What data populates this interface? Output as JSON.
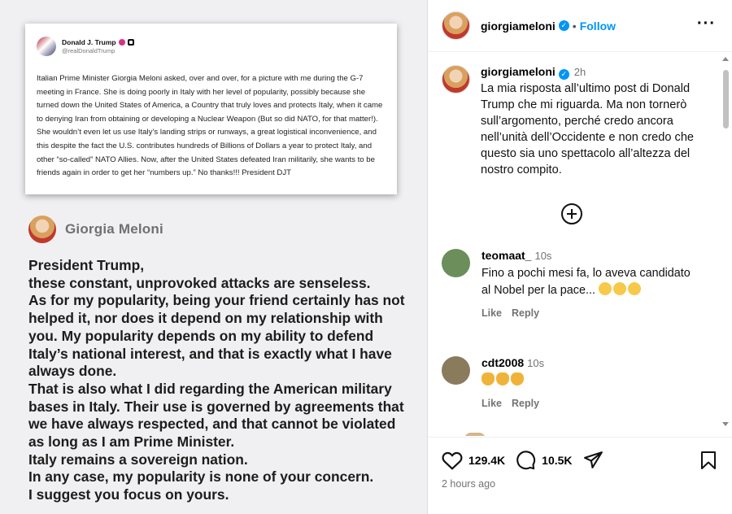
{
  "post_image": {
    "tweet": {
      "name": "Donald J. Trump",
      "handle": "@realDonaldTrump",
      "text": "Italian Prime Minister Giorgia Meloni asked, over and over, for a picture with me during the G-7 meeting in France. She is doing poorly in Italy with her level of popularity, possibly because she turned down the United States of America, a Country that truly loves and protects Italy, when it came to denying Iran from obtaining or developing a Nuclear Weapon (But so did NATO, for that matter!). She wouldn’t even let us use Italy’s landing strips or runways, a great logistical inconvenience, and this despite the fact the U.S. contributes hundreds of Billions of Dollars a year to protect Italy, and other “so-called” NATO Allies. Now, after the United States defeated Iran militarily, she wants to be friends again in order to get her “numbers up.” No thanks!!! President DJT"
    },
    "reply": {
      "name": "Giorgia Meloni",
      "lines": [
        "President Trump,\nthese constant, unprovoked attacks are senseless.\nAs for my popularity, being your friend certainly has not helped it, nor does it depend on my relationship with you. My popularity depends on my ability to defend Italy’s national interest, and that is exactly what I have always done.",
        "That is also what I did regarding the American military bases in Italy. Their use is governed by agreements that we have always respected, and that cannot be violated as long as I am Prime Minister.\nItaly remains a sovereign nation.",
        "In any case, my popularity is none of your concern.\nI suggest you focus on yours."
      ]
    }
  },
  "header": {
    "username": "giorgiameloni",
    "separator": "•",
    "follow_label": "Follow",
    "more_label": "···"
  },
  "caption": {
    "username": "giorgiameloni",
    "time": "2h",
    "text": "La mia risposta all’ultimo post di Donald Trump che mi riguarda. Ma non tornerò sull’argomento, perché credo ancora nell’unità dell’Occidente e non credo che questo sia uno spettacolo all’altezza del nostro compito."
  },
  "comments": [
    {
      "username": "teomaat_",
      "time": "10s",
      "text": "Fino a pochi mesi fa, lo aveva candidato al Nobel per la pace...",
      "like_label": "Like",
      "reply_label": "Reply",
      "avatar_color": "#6b8e5a"
    },
    {
      "username": "cdt2008",
      "time": "10s",
      "text": "",
      "like_label": "Like",
      "reply_label": "Reply",
      "avatar_color": "#8a7b5c"
    }
  ],
  "actions": {
    "likes": "129.4K",
    "comments": "10.5K",
    "posted": "2 hours ago"
  },
  "colors": {
    "accent": "#0095f6",
    "muted": "#737373"
  }
}
